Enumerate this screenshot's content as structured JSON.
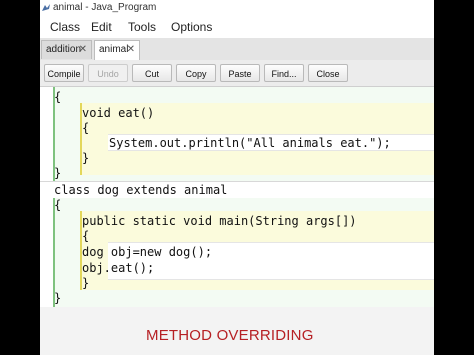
{
  "window": {
    "title": "animal - Java_Program"
  },
  "menu": {
    "items": [
      "Class",
      "Edit",
      "Tools",
      "Options"
    ]
  },
  "tabs": [
    {
      "label": "addition",
      "close": "✕"
    },
    {
      "label": "animal",
      "close": "✕"
    }
  ],
  "toolbar": {
    "compile": "Compile",
    "undo": "Undo",
    "cut": "Cut",
    "copy": "Copy",
    "paste": "Paste",
    "find": "Find...",
    "close": "Close"
  },
  "code": {
    "lines": [
      "{",
      "void eat()",
      "{",
      "System.out.println(\"All animals eat.\");",
      "}",
      "}",
      "class dog extends animal",
      "{",
      "public static void main(String args[])",
      "{",
      "dog obj=new dog();",
      "obj.eat();",
      "}",
      "}"
    ]
  },
  "caption": "METHOD OVERRIDING"
}
